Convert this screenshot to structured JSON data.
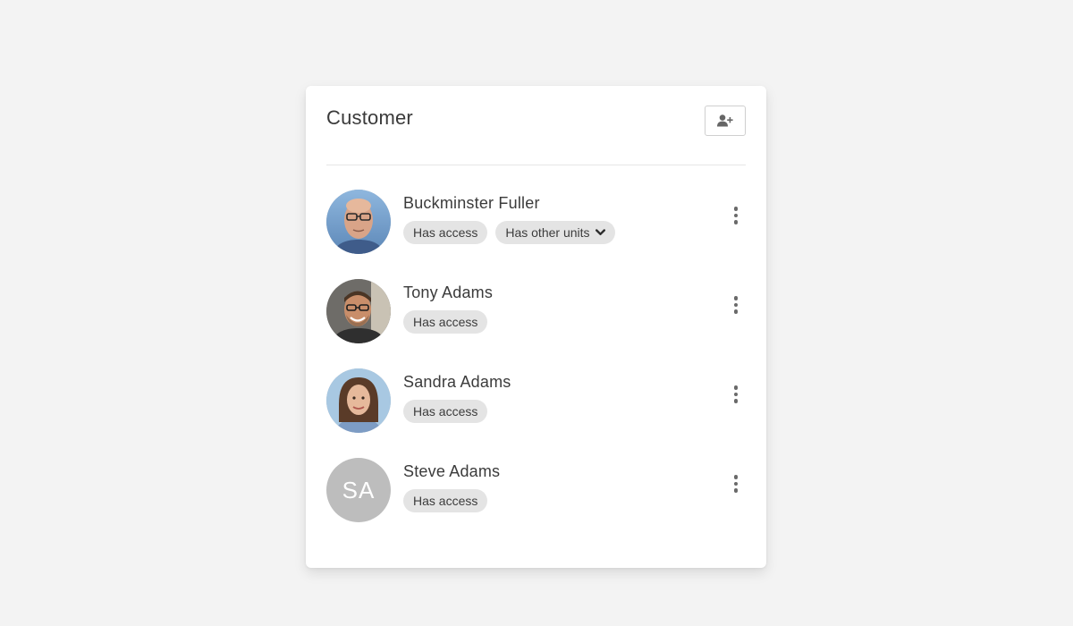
{
  "panel": {
    "title": "Customer",
    "add_button_icon": "add-user-icon"
  },
  "members": [
    {
      "name": "Buckminster Fuller",
      "avatar": "photo",
      "chips": [
        "Has access"
      ],
      "dropdown_chip": "Has other units",
      "menu_icon": "more-vertical-icon"
    },
    {
      "name": "Tony Adams",
      "avatar": "photo",
      "chips": [
        "Has access"
      ],
      "menu_icon": "more-vertical-icon"
    },
    {
      "name": "Sandra Adams",
      "avatar": "photo",
      "chips": [
        "Has access"
      ],
      "menu_icon": "more-vertical-icon"
    },
    {
      "name": "Steve Adams",
      "avatar": "initials",
      "initials": "SA",
      "chips": [
        "Has access"
      ],
      "menu_icon": "more-vertical-icon"
    }
  ],
  "colors": {
    "page_background": "#f3f3f3",
    "card_background": "#ffffff",
    "chip_background": "#e4e4e4",
    "initials_avatar": "#bdbdbd",
    "text": "#3b3b3b"
  }
}
